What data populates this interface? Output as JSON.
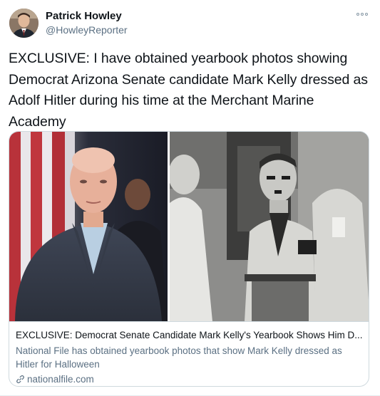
{
  "tweet": {
    "author": {
      "display_name": "Patrick Howley",
      "handle": "@HowleyReporter",
      "avatar_icon": "user-avatar-photo"
    },
    "more_icon": "more-options-icon",
    "text": "EXCLUSIVE: I have obtained yearbook photos showing Democrat Arizona Senate candidate Mark Kelly dressed as Adolf Hitler during his time at the Merchant Marine Academy",
    "link_card": {
      "title": "EXCLUSIVE: Democrat Senate Candidate Mark Kelly's Yearbook Shows Him D...",
      "description": "National File has obtained yearbook photos that show Mark Kelly dressed as Hitler for Halloween",
      "domain": "nationalfile.com",
      "domain_icon": "link-icon"
    }
  },
  "colors": {
    "text_primary": "#0f1419",
    "text_secondary": "#5b7083",
    "border": "#cfd9de"
  }
}
